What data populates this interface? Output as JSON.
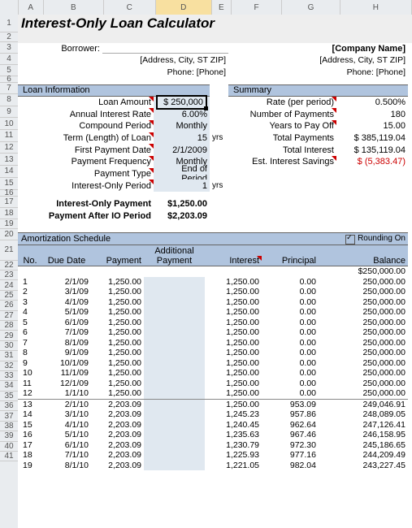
{
  "title": "Interest-Only Loan Calculator",
  "borrower_label": "Borrower:",
  "address_hint": "[Address, City, ST  ZIP]",
  "phone_hint": "Phone: [Phone]",
  "company_name": "[Company Name]",
  "company_address": "[Address, City, ST  ZIP]",
  "company_phone": "Phone: [Phone]",
  "loan_info_hdr": "Loan Information",
  "summary_hdr": "Summary",
  "labels": {
    "loan_amount": "Loan Amount",
    "annual_rate": "Annual Interest Rate",
    "compound": "Compound Period",
    "term": "Term (Length) of Loan",
    "first_date": "First Payment Date",
    "pay_freq": "Payment Frequency",
    "pay_type": "Payment Type",
    "io_period": "Interest-Only Period",
    "rate_per": "Rate (per period)",
    "num_pay": "Number of Payments",
    "years_off": "Years to Pay Off",
    "total_pay": "Total Payments",
    "total_int": "Total Interest",
    "est_save": "Est. Interest Savings"
  },
  "vals": {
    "loan_amount": "$     250,000",
    "annual_rate": "6.00%",
    "compound": "Monthly",
    "term": "15",
    "term_unit": "yrs",
    "first_date": "2/1/2009",
    "pay_freq": "Monthly",
    "pay_type": "End of Period",
    "io_period": "1",
    "io_unit": "yrs",
    "rate_per": "0.500%",
    "num_pay": "180",
    "years_off": "15.00",
    "total_pay": "$  385,119.04",
    "total_int": "$  135,119.04",
    "est_save": "$    (5,383.47)"
  },
  "io_payment_label": "Interest-Only Payment",
  "io_payment": "$1,250.00",
  "after_io_label": "Payment After IO Period",
  "after_io": "$2,203.09",
  "amort_hdr": "Amortization Schedule",
  "rounding": "Rounding On",
  "cols": {
    "no": "No.",
    "due": "Due Date",
    "pay": "Payment",
    "addl1": "Additional",
    "addl2": "Payment",
    "int": "Interest",
    "prin": "Principal",
    "bal": "Balance"
  },
  "start_bal": "$250,000.00",
  "rows": [
    {
      "n": "1",
      "d": "2/1/09",
      "p": "1,250.00",
      "i": "1,250.00",
      "pr": "0.00",
      "b": "250,000.00"
    },
    {
      "n": "2",
      "d": "3/1/09",
      "p": "1,250.00",
      "i": "1,250.00",
      "pr": "0.00",
      "b": "250,000.00"
    },
    {
      "n": "3",
      "d": "4/1/09",
      "p": "1,250.00",
      "i": "1,250.00",
      "pr": "0.00",
      "b": "250,000.00"
    },
    {
      "n": "4",
      "d": "5/1/09",
      "p": "1,250.00",
      "i": "1,250.00",
      "pr": "0.00",
      "b": "250,000.00"
    },
    {
      "n": "5",
      "d": "6/1/09",
      "p": "1,250.00",
      "i": "1,250.00",
      "pr": "0.00",
      "b": "250,000.00"
    },
    {
      "n": "6",
      "d": "7/1/09",
      "p": "1,250.00",
      "i": "1,250.00",
      "pr": "0.00",
      "b": "250,000.00"
    },
    {
      "n": "7",
      "d": "8/1/09",
      "p": "1,250.00",
      "i": "1,250.00",
      "pr": "0.00",
      "b": "250,000.00"
    },
    {
      "n": "8",
      "d": "9/1/09",
      "p": "1,250.00",
      "i": "1,250.00",
      "pr": "0.00",
      "b": "250,000.00"
    },
    {
      "n": "9",
      "d": "10/1/09",
      "p": "1,250.00",
      "i": "1,250.00",
      "pr": "0.00",
      "b": "250,000.00"
    },
    {
      "n": "10",
      "d": "11/1/09",
      "p": "1,250.00",
      "i": "1,250.00",
      "pr": "0.00",
      "b": "250,000.00"
    },
    {
      "n": "11",
      "d": "12/1/09",
      "p": "1,250.00",
      "i": "1,250.00",
      "pr": "0.00",
      "b": "250,000.00"
    },
    {
      "n": "12",
      "d": "1/1/10",
      "p": "1,250.00",
      "i": "1,250.00",
      "pr": "0.00",
      "b": "250,000.00"
    },
    {
      "n": "13",
      "d": "2/1/10",
      "p": "2,203.09",
      "i": "1,250.00",
      "pr": "953.09",
      "b": "249,046.91"
    },
    {
      "n": "14",
      "d": "3/1/10",
      "p": "2,203.09",
      "i": "1,245.23",
      "pr": "957.86",
      "b": "248,089.05"
    },
    {
      "n": "15",
      "d": "4/1/10",
      "p": "2,203.09",
      "i": "1,240.45",
      "pr": "962.64",
      "b": "247,126.41"
    },
    {
      "n": "16",
      "d": "5/1/10",
      "p": "2,203.09",
      "i": "1,235.63",
      "pr": "967.46",
      "b": "246,158.95"
    },
    {
      "n": "17",
      "d": "6/1/10",
      "p": "2,203.09",
      "i": "1,230.79",
      "pr": "972.30",
      "b": "245,186.65"
    },
    {
      "n": "18",
      "d": "7/1/10",
      "p": "2,203.09",
      "i": "1,225.93",
      "pr": "977.16",
      "b": "244,209.49"
    },
    {
      "n": "19",
      "d": "8/1/10",
      "p": "2,203.09",
      "i": "1,221.05",
      "pr": "982.04",
      "b": "243,227.45"
    }
  ],
  "colletters": [
    "A",
    "B",
    "C",
    "D",
    "E",
    "F",
    "G",
    "H"
  ],
  "rownums": [
    1,
    2,
    3,
    4,
    5,
    6,
    7,
    8,
    9,
    10,
    11,
    12,
    13,
    14,
    15,
    16,
    17,
    18,
    19,
    20,
    21,
    22,
    23,
    24,
    25,
    26,
    27,
    28,
    29,
    30,
    31,
    32,
    33,
    34,
    35,
    36,
    37,
    38,
    39,
    40,
    41
  ]
}
